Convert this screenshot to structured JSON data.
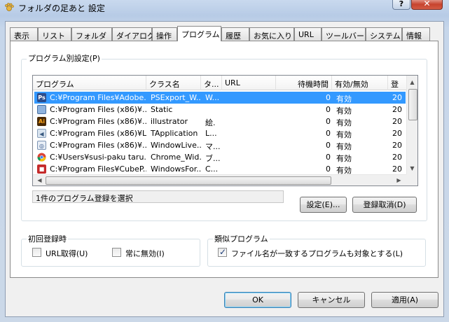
{
  "window": {
    "title": "フォルダの足あと 設定",
    "help_label": "?",
    "close_label": "✕"
  },
  "tabs": [
    {
      "label": "表示"
    },
    {
      "label": "リスト"
    },
    {
      "label": "フォルダ"
    },
    {
      "label": "ダイアログ"
    },
    {
      "label": "操作"
    },
    {
      "label": "プログラム"
    },
    {
      "label": "履歴"
    },
    {
      "label": "お気に入り"
    },
    {
      "label": "URL"
    },
    {
      "label": "ツールバー"
    },
    {
      "label": "システム"
    },
    {
      "label": "情報"
    }
  ],
  "program_group": {
    "label": "プログラム別設定(P)",
    "columns": [
      "プログラム",
      "クラス名",
      "タ...",
      "URL",
      "待機時間",
      "有効/無効",
      "登"
    ],
    "rows": [
      {
        "icon": "photoshop-icon",
        "program": "C:¥Program Files¥Adobe...",
        "class": "PSExport_W...",
        "title": "W...",
        "url": "",
        "wait": "0",
        "enabled": "有効",
        "reg": "20"
      },
      {
        "icon": "generic-app-icon",
        "program": "C:¥Program Files (x86)¥...",
        "class": "Static",
        "title": "",
        "url": "",
        "wait": "0",
        "enabled": "有効",
        "reg": "20"
      },
      {
        "icon": "illustrator-icon",
        "program": "C:¥Program Files (x86)¥...",
        "class": "illustrator",
        "title": "絵.",
        "url": "",
        "wait": "0",
        "enabled": "有効",
        "reg": "20"
      },
      {
        "icon": "speaker-icon",
        "program": "C:¥Program Files (x86)¥L...",
        "class": "TApplication",
        "title": "L...",
        "url": "",
        "wait": "0",
        "enabled": "有効",
        "reg": "20"
      },
      {
        "icon": "windows-live-icon",
        "program": "C:¥Program Files (x86)¥...",
        "class": "WindowLive...",
        "title": "マ...",
        "url": "",
        "wait": "0",
        "enabled": "有効",
        "reg": "20"
      },
      {
        "icon": "chrome-icon",
        "program": "C:¥Users¥susi-paku taru...",
        "class": "Chrome_Wid...",
        "title": "ブ...",
        "url": "",
        "wait": "0",
        "enabled": "有効",
        "reg": "20"
      },
      {
        "icon": "cube-icon",
        "program": "C:¥Program Files¥CubeP...",
        "class": "WindowsFor...",
        "title": "C...",
        "url": "",
        "wait": "0",
        "enabled": "有効",
        "reg": "20"
      }
    ],
    "selected_row": 0,
    "status_text": "1件のプログラム登録を選択",
    "settings_button": "設定(E)...",
    "unregister_button": "登録取消(D)"
  },
  "first_registration": {
    "label": "初回登録時",
    "url_checkbox": {
      "label": "URL取得(U)",
      "checked": false
    },
    "disable_checkbox": {
      "label": "常に無効(I)",
      "checked": false
    }
  },
  "similar_program": {
    "label": "類似プログラム",
    "checkbox": {
      "label": "ファイル名が一致するプログラムも対象とする(L)",
      "checked": true
    }
  },
  "footer": {
    "ok_label": "OK",
    "cancel_label": "キャンセル",
    "apply_label": "適用(A)"
  },
  "colors": {
    "selection": "#3399ff",
    "close_red": "#c7432e"
  }
}
